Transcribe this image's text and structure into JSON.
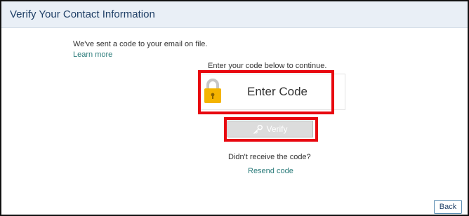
{
  "header": {
    "title": "Verify Your Contact Information"
  },
  "intro": {
    "sent_text": "We've sent a code to your email on file.",
    "learn_more": "Learn more"
  },
  "code_entry": {
    "instructions": "Enter your code below to continue.",
    "placeholder": "Enter Code",
    "icon": "lock-icon"
  },
  "verify": {
    "label": "Verify",
    "icon": "key-icon"
  },
  "resend": {
    "question": "Didn't receive the code?",
    "link": "Resend code"
  },
  "footer": {
    "back_label": "Back"
  },
  "colors": {
    "header_bg": "#e9eff6",
    "title_text": "#1f3f66",
    "link_text": "#2a7b7a",
    "highlight_red": "#e8070f",
    "lock_gold": "#f4b400",
    "button_disabled_bg": "#dcdcdc"
  }
}
